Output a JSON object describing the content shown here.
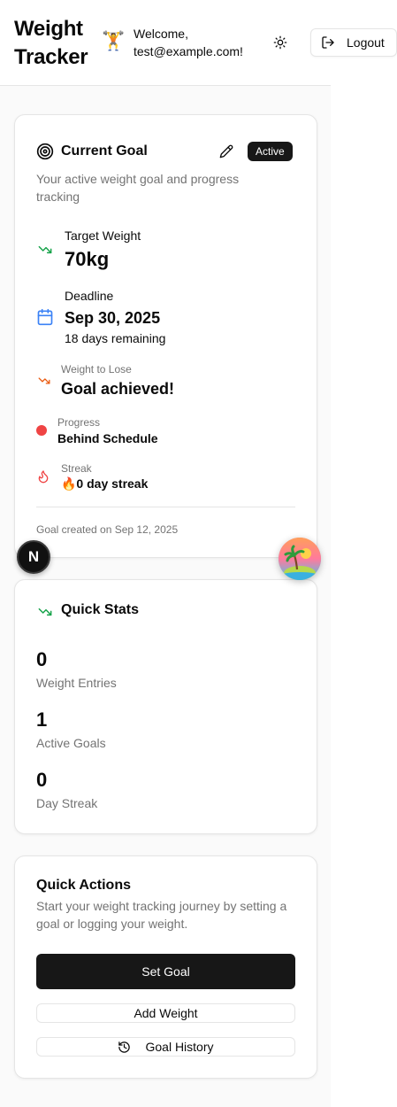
{
  "header": {
    "brand_line1": "Weight",
    "brand_line2": "Tracker",
    "avatar_emoji": "🏋️",
    "welcome_line1": "Welcome,",
    "welcome_line2": "test@example.com!",
    "theme_icon": "sun-icon",
    "logout_label": "Logout",
    "logout_icon": "log-out-icon"
  },
  "current_goal": {
    "title": "Current Goal",
    "title_icon": "target-icon",
    "badge": "Active",
    "edit_icon": "pencil-icon",
    "description": "Your active weight goal and progress tracking",
    "target_label": "Target Weight",
    "target_value": "70kg",
    "target_icon": "trending-down-icon",
    "deadline_label": "Deadline",
    "deadline_value": "Sep 30, 2025",
    "deadline_sub": "18 days remaining",
    "deadline_icon": "calendar-icon",
    "lose_label": "Weight to Lose",
    "lose_value": "Goal achieved!",
    "lose_icon": "trending-down-icon",
    "progress_label": "Progress",
    "progress_value": "Behind Schedule",
    "progress_color": "#ef4444",
    "streak_label": "Streak",
    "streak_value": "🔥0 day streak",
    "streak_icon": "flame-icon",
    "created": "Goal created on Sep 12, 2025"
  },
  "quick_stats": {
    "title": "Quick Stats",
    "title_icon": "trending-down-icon",
    "stats": [
      {
        "value": "0",
        "label": "Weight Entries"
      },
      {
        "value": "1",
        "label": "Active Goals"
      },
      {
        "value": "0",
        "label": "Day Streak"
      }
    ]
  },
  "quick_actions": {
    "title": "Quick Actions",
    "description": "Start your weight tracking journey by setting a goal or logging your weight.",
    "set_goal": "Set Goal",
    "add_weight": "Add Weight",
    "goal_history": "Goal History",
    "history_icon": "history-icon"
  },
  "overlays": {
    "next_badge": "N"
  },
  "colors": {
    "green": "#16a34a",
    "orange": "#ea580c",
    "blue": "#3b82f6",
    "red": "#ef4444"
  }
}
